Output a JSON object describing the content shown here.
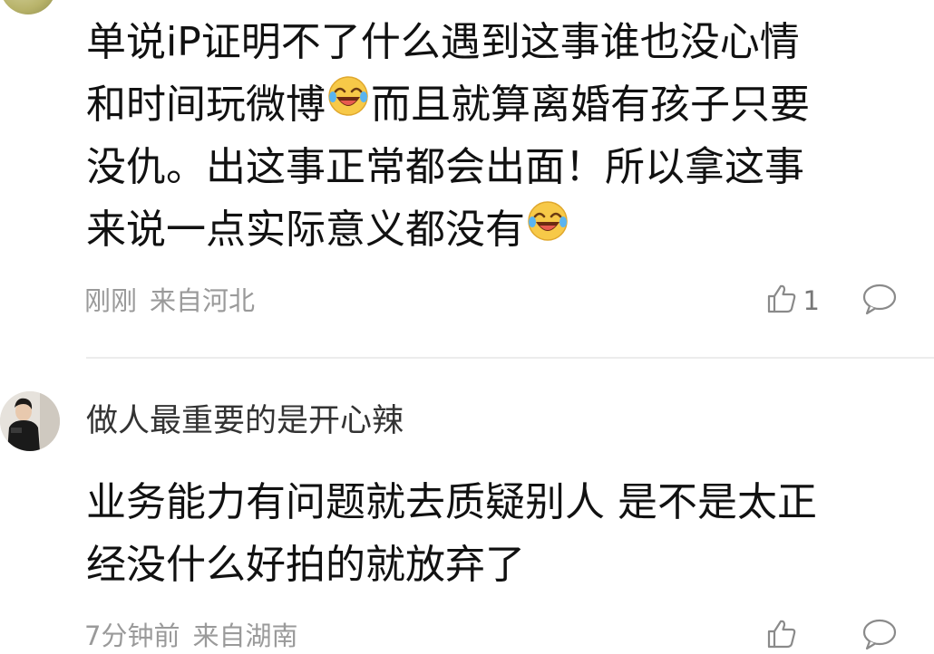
{
  "comments": [
    {
      "username": "",
      "lines": [
        [
          "单说iP证明不了什么遇到这事谁也没心情"
        ],
        [
          "和时间玩微博",
          "而且就算离婚有孩子只要"
        ],
        [
          "没仇。出这事正常都会出面！所以拿这事"
        ],
        [
          "来说一点实际意义都没有",
          ""
        ]
      ],
      "emoji_icon": "laughing-tears-emoji",
      "time": "刚刚",
      "location": "来自河北",
      "likes": "1"
    },
    {
      "username": "做人最重要的是开心辣",
      "lines": [
        [
          "业务能力有问题就去质疑别人 是不是太正"
        ],
        [
          "经没什么好拍的就放弃了"
        ]
      ],
      "time": "7分钟前",
      "location": "来自湖南",
      "likes": ""
    }
  ],
  "icons": {
    "like": "thumbs-up-icon",
    "reply": "comment-bubble-icon"
  },
  "colors": {
    "text": "#111111",
    "meta": "#9a9a9a",
    "divider": "#ececec",
    "emoji_face": "#f7c948"
  }
}
